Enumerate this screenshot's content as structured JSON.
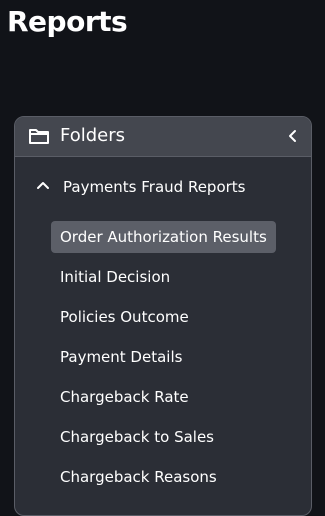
{
  "page": {
    "title": "Reports"
  },
  "folders_panel": {
    "title": "Folders",
    "folder_icon": "folder-icon",
    "collapse_icon": "chevron-left-icon",
    "group": {
      "label": "Payments Fraud Reports",
      "expanded": true,
      "icon": "chevron-up-icon"
    },
    "items": [
      {
        "label": "Order Authorization Results",
        "selected": true
      },
      {
        "label": "Initial Decision",
        "selected": false
      },
      {
        "label": "Policies Outcome",
        "selected": false
      },
      {
        "label": "Payment Details",
        "selected": false
      },
      {
        "label": "Chargeback Rate",
        "selected": false
      },
      {
        "label": "Chargeback to Sales",
        "selected": false
      },
      {
        "label": "Chargeback Reasons",
        "selected": false
      }
    ]
  },
  "colors": {
    "page_background": "#111318",
    "panel_background": "#2b2e36",
    "panel_header_background": "#44474f",
    "panel_border": "#5a5d66",
    "selected_item_background": "#5c5f68",
    "text": "#ffffff"
  }
}
